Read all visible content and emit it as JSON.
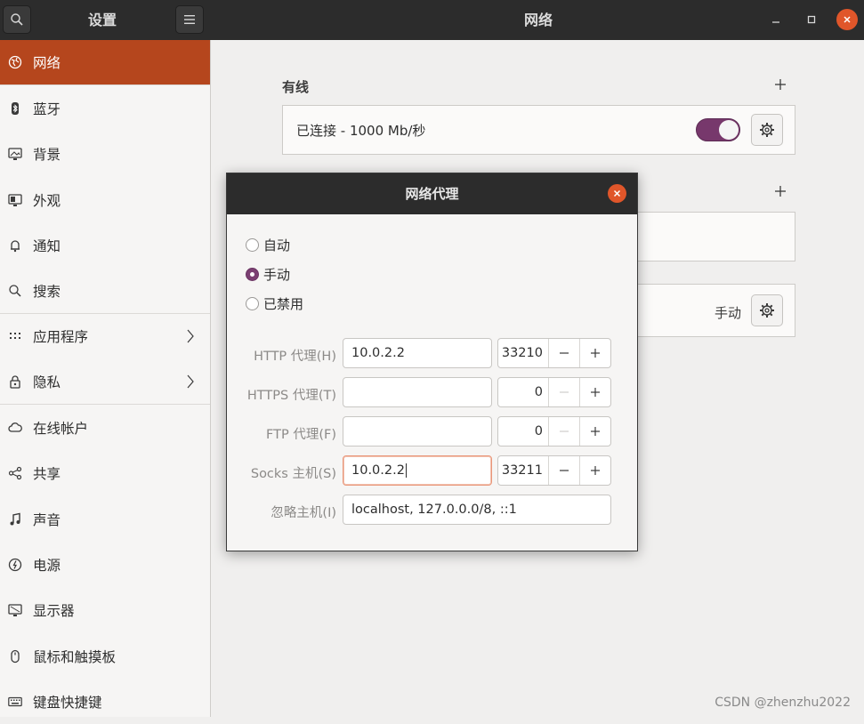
{
  "header": {
    "sidebar_title": "设置",
    "title": "网络",
    "search_icon": "search-icon",
    "menu_icon": "hamburger-menu-icon"
  },
  "sidebar": {
    "items": [
      {
        "label": "网络",
        "icon": "network-icon"
      },
      {
        "label": "蓝牙",
        "icon": "bluetooth-icon"
      },
      {
        "label": "背景",
        "icon": "background-icon"
      },
      {
        "label": "外观",
        "icon": "appearance-icon"
      },
      {
        "label": "通知",
        "icon": "bell-icon"
      },
      {
        "label": "搜索",
        "icon": "search-icon"
      },
      {
        "label": "应用程序",
        "icon": "apps-grid-icon"
      },
      {
        "label": "隐私",
        "icon": "lock-icon"
      },
      {
        "label": "在线帐户",
        "icon": "cloud-icon"
      },
      {
        "label": "共享",
        "icon": "share-icon"
      },
      {
        "label": "声音",
        "icon": "music-note-icon"
      },
      {
        "label": "电源",
        "icon": "power-icon"
      },
      {
        "label": "显示器",
        "icon": "display-icon"
      },
      {
        "label": "鼠标和触摸板",
        "icon": "mouse-icon"
      },
      {
        "label": "键盘快捷键",
        "icon": "keyboard-icon"
      }
    ]
  },
  "main": {
    "wired": {
      "title": "有线",
      "status": "已连接 - 1000 Mb/秒",
      "enabled": true
    },
    "proxy": {
      "value": "手动"
    }
  },
  "dialog": {
    "title": "网络代理",
    "modes": [
      {
        "label": "自动",
        "selected": false
      },
      {
        "label": "手动",
        "selected": true
      },
      {
        "label": "已禁用",
        "selected": false
      }
    ],
    "fields": {
      "http": {
        "label": "HTTP 代理(H)",
        "host": "10.0.2.2",
        "port": "33210"
      },
      "https": {
        "label": "HTTPS 代理(T)",
        "host": "",
        "port": "0"
      },
      "ftp": {
        "label": "FTP 代理(F)",
        "host": "",
        "port": "0"
      },
      "socks": {
        "label": "Socks 主机(S)",
        "host": "10.0.2.2",
        "port": "33211"
      },
      "ignore": {
        "label": "忽略主机(I)",
        "value": "localhost, 127.0.0.0/8, ::1"
      }
    }
  },
  "watermark": "CSDN @zhenzhu2022",
  "colors": {
    "accent": "#b5461d",
    "toggle_on": "#77386c",
    "close_orange": "#e0562a",
    "header_dark": "#2c2c2c"
  }
}
